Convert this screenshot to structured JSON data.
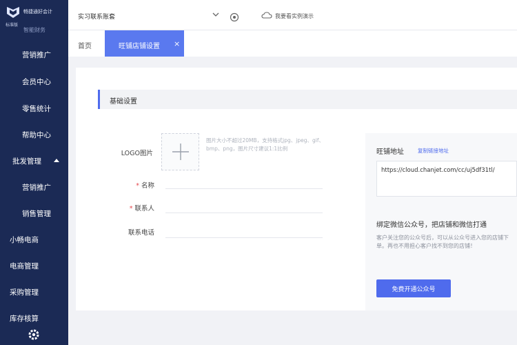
{
  "sidebar": {
    "brand_name": "畅捷通好会计",
    "brand_sub": "标准版",
    "cut_item": "智能财务",
    "items": [
      {
        "label": "营销推广",
        "kind": "sub"
      },
      {
        "label": "会员中心",
        "kind": "sub"
      },
      {
        "label": "零售统计",
        "kind": "sub"
      },
      {
        "label": "帮助中心",
        "kind": "sub"
      },
      {
        "label": "批发管理",
        "kind": "group"
      },
      {
        "label": "营销推广",
        "kind": "sub"
      },
      {
        "label": "销售管理",
        "kind": "sub"
      },
      {
        "label": "小畅电商",
        "kind": "top"
      },
      {
        "label": "电商管理",
        "kind": "top"
      },
      {
        "label": "采购管理",
        "kind": "top"
      },
      {
        "label": "库存核算",
        "kind": "top"
      }
    ]
  },
  "topbar": {
    "org": "实习联系账套",
    "demo_text": "我要看实例演示"
  },
  "tabs": {
    "home": "首页",
    "active": "旺铺店铺设置",
    "close": "×"
  },
  "section": {
    "title": "基础设置"
  },
  "form": {
    "logo_label": "LOGO图片",
    "upload_hint": "图片大小不超过20MB，支持格式jpg、jpeg、gif、bmp、png，图片尺寸建议1:1比例",
    "name_label": "名称",
    "contact_label": "联系人",
    "phone_label": "联系电话",
    "required_mark": "*"
  },
  "panel": {
    "addr_label": "旺铺地址",
    "copy_link": "复制链接地址",
    "url": "https://cloud.chanjet.com/cc/uj5df31tl/",
    "bind_title": "绑定微信公众号，把店铺和微信打通",
    "bind_desc": "客户关注您的公众号后，可以从公众号进入您的店铺下单。再也不用担心客户找不到您的店铺！",
    "bind_button": "免费开通公众号"
  },
  "colors": {
    "sidebar_bg": "#1b2a55",
    "accent": "#4f6bed",
    "active_tab": "#5a79ef",
    "required": "#e5484d"
  }
}
